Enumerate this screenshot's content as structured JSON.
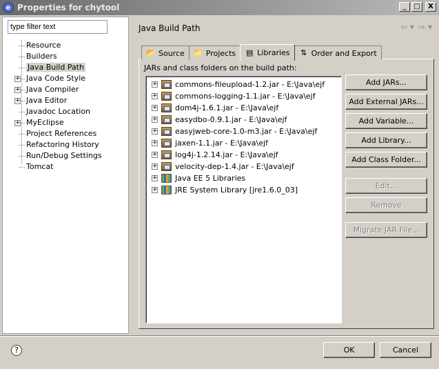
{
  "window": {
    "title": "Properties for chytool",
    "app_icon": "eclipse-icon"
  },
  "window_buttons": [
    "_",
    "□",
    "X"
  ],
  "filter": {
    "placeholder": "type filter text",
    "value": "type filter text"
  },
  "tree": [
    {
      "label": "Resource",
      "expandable": false
    },
    {
      "label": "Builders",
      "expandable": false
    },
    {
      "label": "Java Build Path",
      "expandable": false,
      "selected": true
    },
    {
      "label": "Java Code Style",
      "expandable": true
    },
    {
      "label": "Java Compiler",
      "expandable": true
    },
    {
      "label": "Java Editor",
      "expandable": true
    },
    {
      "label": "Javadoc Location",
      "expandable": false
    },
    {
      "label": "MyEclipse",
      "expandable": true
    },
    {
      "label": "Project References",
      "expandable": false
    },
    {
      "label": "Refactoring History",
      "expandable": false
    },
    {
      "label": "Run/Debug Settings",
      "expandable": false
    },
    {
      "label": "Tomcat",
      "expandable": false
    }
  ],
  "header": {
    "title": "Java Build Path",
    "nav": [
      "⇦ ▾",
      "⇨ ▾"
    ]
  },
  "tabs": [
    {
      "label": "Source",
      "icon": "source-folder-icon",
      "glyph": "📂"
    },
    {
      "label": "Projects",
      "icon": "projects-icon",
      "glyph": "📁"
    },
    {
      "label": "Libraries",
      "icon": "libraries-icon",
      "glyph": "▤",
      "active": true
    },
    {
      "label": "Order and Export",
      "icon": "order-export-icon",
      "glyph": "⇅"
    }
  ],
  "panel": {
    "caption": "JARs and class folders on the build path:"
  },
  "jars": [
    {
      "label": "commons-fileupload-1.2.jar - E:\\Java\\ejf",
      "kind": "jar"
    },
    {
      "label": "commons-logging-1.1.jar - E:\\Java\\ejf",
      "kind": "jar"
    },
    {
      "label": "dom4j-1.6.1.jar - E:\\Java\\ejf",
      "kind": "jar"
    },
    {
      "label": "easydbo-0.9.1.jar - E:\\Java\\ejf",
      "kind": "jar"
    },
    {
      "label": "easyjweb-core-1.0-m3.jar - E:\\Java\\ejf",
      "kind": "jar"
    },
    {
      "label": "jaxen-1.1.jar - E:\\Java\\ejf",
      "kind": "jar"
    },
    {
      "label": "log4j-1.2.14.jar - E:\\Java\\ejf",
      "kind": "jar"
    },
    {
      "label": "velocity-dep-1.4.jar - E:\\Java\\ejf",
      "kind": "jar"
    },
    {
      "label": "Java EE 5 Libraries",
      "kind": "lib"
    },
    {
      "label": "JRE System Library [jre1.6.0_03]",
      "kind": "lib"
    }
  ],
  "side_buttons": [
    {
      "label": "Add JARs...",
      "name": "add-jars-button",
      "enabled": true
    },
    {
      "label": "Add External JARs...",
      "name": "add-external-jars-button",
      "enabled": true
    },
    {
      "label": "Add Variable...",
      "name": "add-variable-button",
      "enabled": true
    },
    {
      "label": "Add Library...",
      "name": "add-library-button",
      "enabled": true
    },
    {
      "label": "Add Class Folder...",
      "name": "add-class-folder-button",
      "enabled": true
    },
    {
      "label": "Edit...",
      "name": "edit-button",
      "enabled": false
    },
    {
      "label": "Remove",
      "name": "remove-button",
      "enabled": false
    },
    {
      "label": "Migrate JAR File...",
      "name": "migrate-jar-file-button",
      "enabled": false
    }
  ],
  "footer": {
    "help": "?",
    "ok": "OK",
    "cancel": "Cancel"
  }
}
